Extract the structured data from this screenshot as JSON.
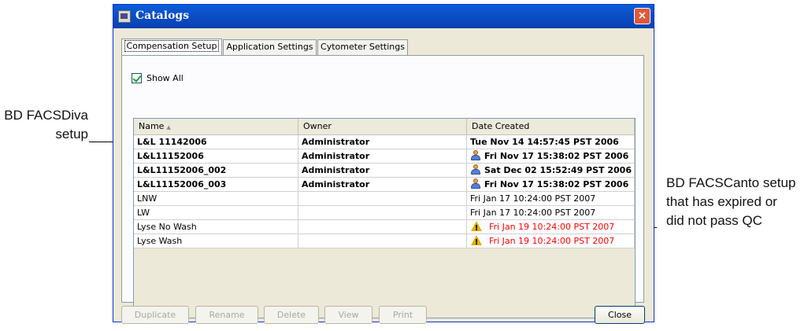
{
  "window": {
    "title": "Catalogs",
    "close_glyph": "×"
  },
  "tabs": [
    {
      "label": "Compensation Setup",
      "active": true
    },
    {
      "label": "Application Settings",
      "active": false
    },
    {
      "label": "Cytometer Settings",
      "active": false
    }
  ],
  "show_all": {
    "label": "Show All",
    "checked": true
  },
  "table": {
    "columns": [
      "Name",
      "Owner",
      "Date Created"
    ],
    "sort_indicator": "▲",
    "rows": [
      {
        "name": "L&L 11142006",
        "owner": "Administrator",
        "date": "Tue Nov 14 14:57:45 PST 2006",
        "icon": "",
        "style": "bold"
      },
      {
        "name": "L&L11152006",
        "owner": "Administrator",
        "date": "Fri Nov 17 15:38:02 PST 2006",
        "icon": "user-icon",
        "style": "bold"
      },
      {
        "name": "L&L11152006_002",
        "owner": "Administrator",
        "date": "Sat Dec 02 15:52:49 PST 2006",
        "icon": "user-icon",
        "style": "bold"
      },
      {
        "name": "L&L11152006_003",
        "owner": "Administrator",
        "date": "Fri Nov 17 15:38:02 PST 2006",
        "icon": "user-icon",
        "style": "bold"
      },
      {
        "name": "LNW",
        "owner": "",
        "date": "Fri Jan 17 10:24:00 PST 2007",
        "icon": "",
        "style": "normal"
      },
      {
        "name": "LW",
        "owner": "",
        "date": "Fri Jan 17 10:24:00 PST 2007",
        "icon": "",
        "style": "normal"
      },
      {
        "name": "Lyse No Wash",
        "owner": "",
        "date": "Fri Jan 19 10:24:00 PST 2007",
        "icon": "warning-icon",
        "style": "expired"
      },
      {
        "name": "Lyse Wash",
        "owner": "",
        "date": "Fri Jan 19 10:24:00 PST 2007",
        "icon": "warning-icon",
        "style": "expired"
      }
    ]
  },
  "buttons": {
    "duplicate": "Duplicate",
    "rename": "Rename",
    "delete": "Delete",
    "view": "View",
    "print": "Print",
    "close": "Close"
  },
  "callouts": {
    "left": [
      "BD FACSDiva",
      "setup"
    ],
    "right": [
      "BD FACSCanto setup",
      "that has expired or",
      "did not pass QC"
    ]
  },
  "colors": {
    "titlebar": "#0a5fd8",
    "expired_text": "#ff0000",
    "dialog_bg": "#ece9d8"
  }
}
